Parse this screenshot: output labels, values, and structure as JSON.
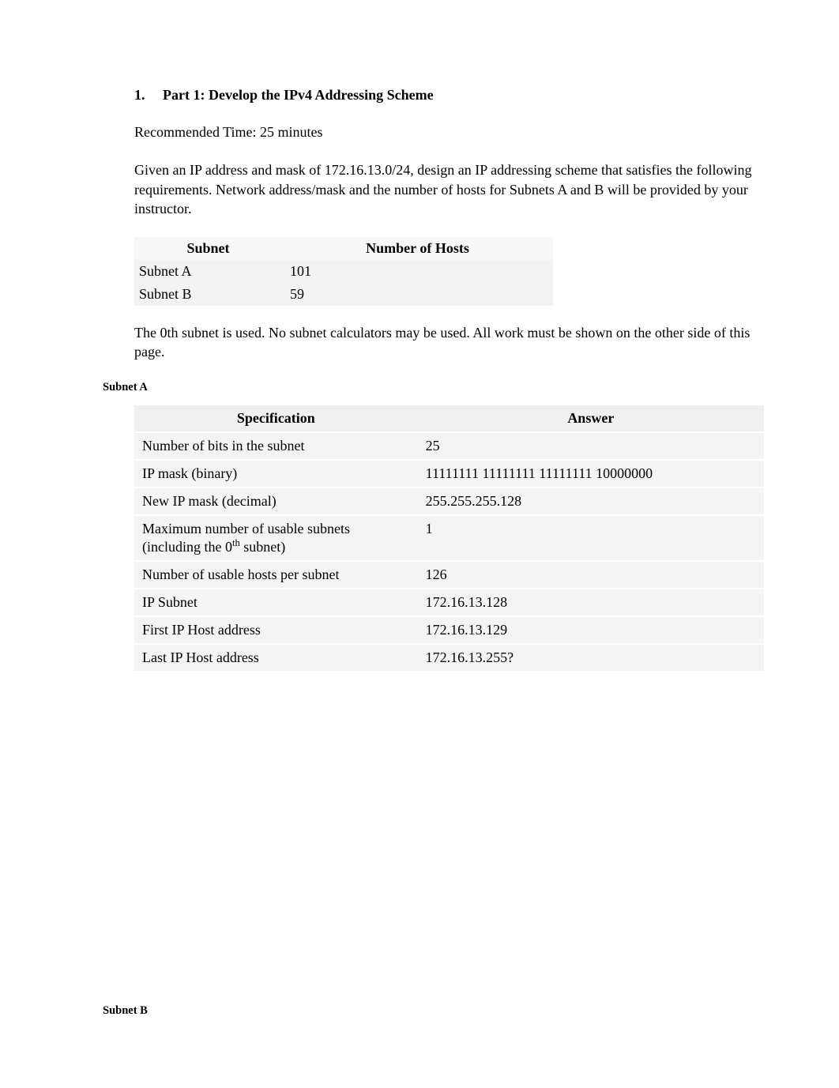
{
  "heading": {
    "number": "1.",
    "text": "Part 1: Develop the IPv4 Addressing Scheme"
  },
  "paragraphs": {
    "time": "Recommended Time: 25 minutes",
    "intro": "Given an IP address and mask of 172.16.13.0/24, design an IP addressing scheme that satisfies the following requirements. Network address/mask and the number of hosts for Subnets A and B will be provided by your instructor.",
    "rules": "The 0th subnet is used. No subnet calculators may be used. All work must be shown on the other side of this page."
  },
  "hosts_table": {
    "headers": [
      "Subnet",
      "Number of Hosts"
    ],
    "rows": [
      {
        "subnet": "Subnet A",
        "hosts": "101"
      },
      {
        "subnet": "Subnet B",
        "hosts": "59"
      }
    ]
  },
  "subnet_a": {
    "title": "Subnet A",
    "headers": [
      "Specification",
      "Answer"
    ],
    "rows": [
      {
        "spec": "Number of bits in the subnet",
        "ans": "25"
      },
      {
        "spec": "IP mask (binary)",
        "ans": "11111111 11111111 11111111 10000000"
      },
      {
        "spec": "New IP mask (decimal)",
        "ans": "255.255.255.128"
      },
      {
        "spec": "Maximum number of usable subnets (including the 0th subnet)",
        "sup": true,
        "ans": "1"
      },
      {
        "spec": "Number of usable hosts per subnet",
        "ans": "126"
      },
      {
        "spec": "IP Subnet",
        "ans": "172.16.13.128"
      },
      {
        "spec": "First IP Host address",
        "ans": "172.16.13.129"
      },
      {
        "spec": "Last IP Host address",
        "ans": "172.16.13.255?"
      }
    ]
  },
  "subnet_b": {
    "title": "Subnet B"
  }
}
